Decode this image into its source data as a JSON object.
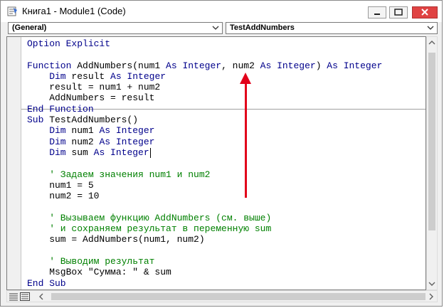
{
  "window": {
    "title": "Книга1 - Module1 (Code)",
    "buttons": {
      "minimize": "–",
      "maximize": "☐",
      "close": "✕"
    }
  },
  "combos": {
    "object": "(General)",
    "procedure": "TestAddNumbers"
  },
  "code": {
    "lines": [
      [
        {
          "t": "Option Explicit",
          "c": "kw"
        }
      ],
      [],
      [
        {
          "t": "Function ",
          "c": "kw"
        },
        {
          "t": "AddNumbers(num1 ",
          "c": "tx"
        },
        {
          "t": "As Integer",
          "c": "kw"
        },
        {
          "t": ", num2 ",
          "c": "tx"
        },
        {
          "t": "As Integer",
          "c": "kw"
        },
        {
          "t": ") ",
          "c": "tx"
        },
        {
          "t": "As Integer",
          "c": "kw"
        }
      ],
      [
        {
          "t": "    Dim ",
          "c": "kw"
        },
        {
          "t": "result ",
          "c": "tx"
        },
        {
          "t": "As Integer",
          "c": "kw"
        }
      ],
      [
        {
          "t": "    result = num1 + num2",
          "c": "tx"
        }
      ],
      [
        {
          "t": "    AddNumbers = result",
          "c": "tx"
        }
      ],
      [
        {
          "t": "End Function",
          "c": "kw"
        }
      ],
      [
        {
          "t": "Sub ",
          "c": "kw"
        },
        {
          "t": "TestAddNumbers()",
          "c": "tx"
        }
      ],
      [
        {
          "t": "    Dim ",
          "c": "kw"
        },
        {
          "t": "num1 ",
          "c": "tx"
        },
        {
          "t": "As Integer",
          "c": "kw"
        }
      ],
      [
        {
          "t": "    Dim ",
          "c": "kw"
        },
        {
          "t": "num2 ",
          "c": "tx"
        },
        {
          "t": "As Integer",
          "c": "kw"
        }
      ],
      [
        {
          "t": "    Dim ",
          "c": "kw"
        },
        {
          "t": "sum ",
          "c": "tx"
        },
        {
          "t": "As Integer",
          "c": "kw"
        }
      ],
      [],
      [
        {
          "t": "    ' Задаем значения num1 и num2",
          "c": "cm"
        }
      ],
      [
        {
          "t": "    num1 = 5",
          "c": "tx"
        }
      ],
      [
        {
          "t": "    num2 = 10",
          "c": "tx"
        }
      ],
      [],
      [
        {
          "t": "    ' Вызываем функцию AddNumbers (см. выше)",
          "c": "cm"
        }
      ],
      [
        {
          "t": "    ' и сохраняем результат в переменную sum",
          "c": "cm"
        }
      ],
      [
        {
          "t": "    sum = AddNumbers(num1, num2)",
          "c": "tx"
        }
      ],
      [],
      [
        {
          "t": "    ' Выводим результат",
          "c": "cm"
        }
      ],
      [
        {
          "t": "    MsgBox \"Сумма: \" & sum",
          "c": "tx"
        }
      ],
      [
        {
          "t": "End Sub",
          "c": "kw"
        }
      ]
    ],
    "caret_line": 10
  },
  "colors": {
    "keyword": "#00008b",
    "comment": "#008000",
    "text": "#000000",
    "annotation_arrow": "#e2001a",
    "close_button": "#e04343"
  }
}
